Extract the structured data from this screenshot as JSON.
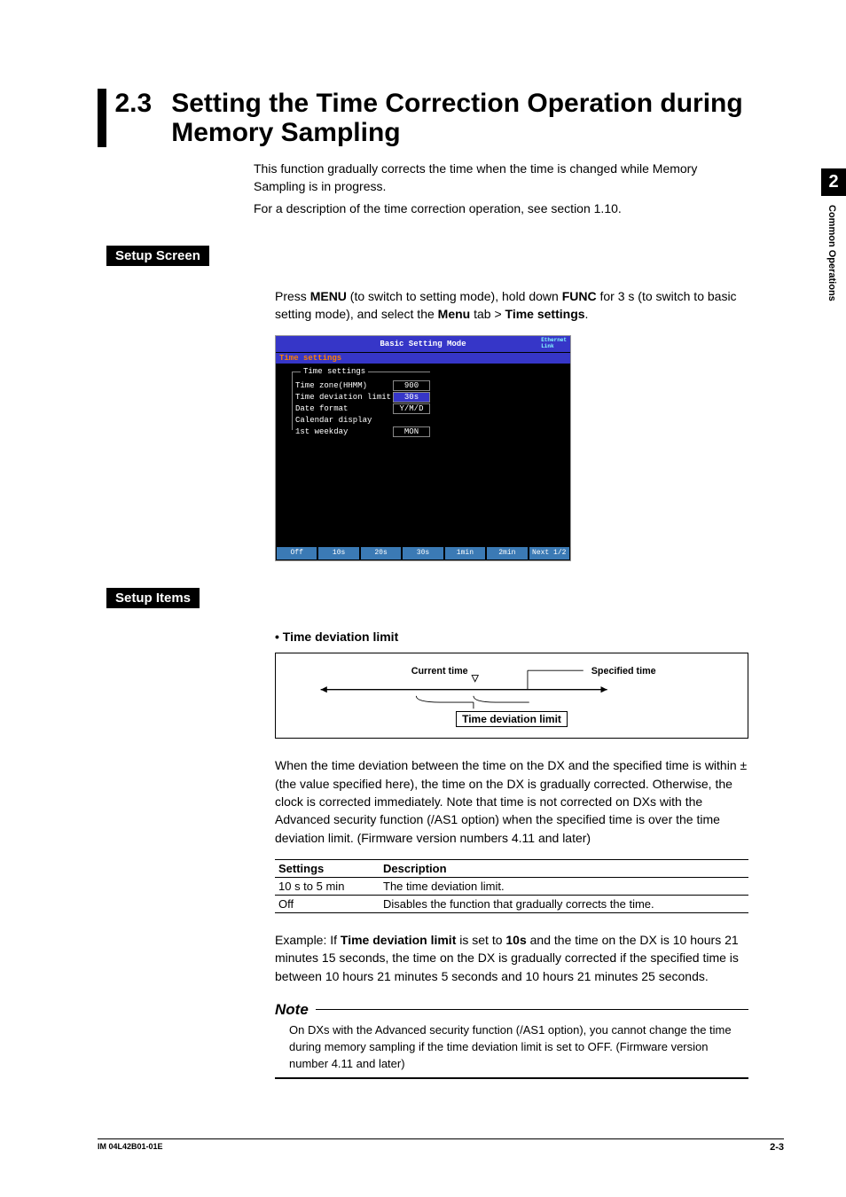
{
  "side": {
    "num": "2",
    "label": "Common Operations"
  },
  "heading": {
    "num": "2.3",
    "text": "Setting the Time Correction Operation during Memory Sampling"
  },
  "intro": {
    "p1": "This function gradually corrects the time when the time is changed while Memory Sampling is in progress.",
    "p2": "For a description of the time correction operation, see section 1.10."
  },
  "setup_screen": {
    "label": "Setup Screen",
    "p_a": "Press ",
    "p_b": "MENU",
    "p_c": " (to switch to setting mode), hold down ",
    "p_d": "FUNC",
    "p_e": " for 3 s (to switch to basic setting mode), and select the ",
    "p_f": "Menu",
    "p_g": " tab > ",
    "p_h": "Time settings",
    "p_i": "."
  },
  "screenshot": {
    "title": "Basic Setting Mode",
    "link": "Ethernet\nLink",
    "crumb": "Time settings",
    "group": "Time settings",
    "rows": [
      {
        "label": "Time zone(HHMM)",
        "val": "900",
        "hl": false
      },
      {
        "label": "Time deviation limit",
        "val": "30s",
        "hl": true
      },
      {
        "label": "Date format",
        "val": "Y/M/D",
        "hl": false
      },
      {
        "label": "Calendar display",
        "val": "",
        "hl": false
      },
      {
        "label": "1st weekday",
        "val": "MON",
        "hl": false
      }
    ],
    "softkeys": [
      "Off",
      "10s",
      "20s",
      "30s",
      "1min",
      "2min",
      "Next 1/2"
    ]
  },
  "setup_items": {
    "label": "Setup Items",
    "bullet": "•   Time deviation limit",
    "diagram": {
      "current": "Current time",
      "specified": "Specified time",
      "box": "Time deviation limit"
    },
    "para": "When the time deviation between the time on the DX and the specified time is within ±(the value specified here), the time on the DX is gradually corrected. Otherwise, the clock is corrected immediately. Note that time is not corrected on DXs with the Advanced security function (/AS1 option) when the specified time is over the time deviation limit. (Firmware version numbers 4.11 and later)",
    "table": {
      "h1": "Settings",
      "h2": "Description",
      "r1c1": "10 s to 5 min",
      "r1c2": "The time deviation limit.",
      "r2c1": "Off",
      "r2c2": "Disables the function that gradually corrects the time."
    },
    "example_a": "Example:   If ",
    "example_b": "Time deviation limit",
    "example_c": " is set to ",
    "example_d": "10s",
    "example_e": " and the time on the DX is 10 hours 21 minutes 15 seconds, the time on the DX is gradually corrected if the specified time is between 10 hours 21 minutes 5 seconds and 10 hours 21 minutes 25 seconds."
  },
  "note": {
    "head": "Note",
    "body": "On DXs with the Advanced security function (/AS1 option), you cannot change the time during memory sampling if the time deviation limit is set to OFF. (Firmware version number 4.11 and later)"
  },
  "footer": {
    "left": "IM 04L42B01-01E",
    "right": "2-3"
  }
}
